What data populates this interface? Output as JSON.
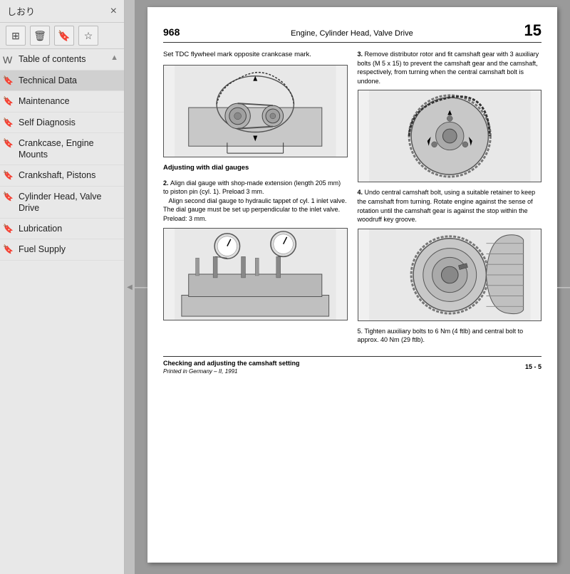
{
  "sidebar": {
    "title": "しおり",
    "close_label": "×",
    "toolbar": {
      "layout_icon": "⊞",
      "delete_icon": "🗑",
      "bookmark_icon": "🔖",
      "star_icon": "☆"
    },
    "items": [
      {
        "id": "table-of-contents",
        "label": "Table of contents",
        "icon": "W",
        "active": false
      },
      {
        "id": "technical-data",
        "label": "Technical Data",
        "icon": "🔖",
        "active": true
      },
      {
        "id": "maintenance",
        "label": "Maintenance",
        "icon": "🔖",
        "active": false
      },
      {
        "id": "self-diagnosis",
        "label": "Self Diagnosis",
        "icon": "🔖",
        "active": false
      },
      {
        "id": "crankcase-engine",
        "label": "Crankcase, Engine Mounts",
        "icon": "🔖",
        "active": false
      },
      {
        "id": "crankshaft-pistons",
        "label": "Crankshaft, Pistons",
        "icon": "🔖",
        "active": false
      },
      {
        "id": "cylinder-head",
        "label": "Cylinder Head, Valve Drive",
        "icon": "🔖",
        "active": false
      },
      {
        "id": "lubrication",
        "label": "Lubrication",
        "icon": "🔖",
        "active": false
      },
      {
        "id": "fuel-supply",
        "label": "Fuel Supply",
        "icon": "🔖",
        "active": false
      }
    ]
  },
  "page": {
    "number_left": "968",
    "chapter_title": "Engine, Cylinder Head, Valve Drive",
    "number_right": "15",
    "intro_text": "Set TDC flywheel mark opposite crankcase mark.",
    "section_title": "Adjusting with dial gauges",
    "step2_text": "2. Align dial gauge with shop-made extension (length 205 mm) to piston pin (cyl. 1). Preload 3 mm.\n    Align second dial gauge to hydraulic tappet of cyl. 1 inlet valve. The dial gauge must be set up perpendicular to the inlet valve. Preload: 3 mm.",
    "step3_text": "3. Remove distributor rotor and fit camshaft gear with 3 auxiliary bolts (M 5 x 15) to prevent the camshaft gear and the camshaft, respectively, from turning when the central camshaft bolt is undone.",
    "step4_text": "4. Undo central camshaft bolt, using a suitable retainer to keep the camshaft from turning. Rotate engine against the sense of rotation until the camshaft gear is against the stop within the woodruff key groove.",
    "step5_text": "5. Tighten auxiliary bolts to 6 Nm (4 ftlb) and central bolt to approx. 40 Nm (29 ftlb).",
    "footer_title": "Checking and adjusting the camshaft setting",
    "footer_page": "15 - 5",
    "footer_printed": "Printed in Germany – II, 1991"
  }
}
